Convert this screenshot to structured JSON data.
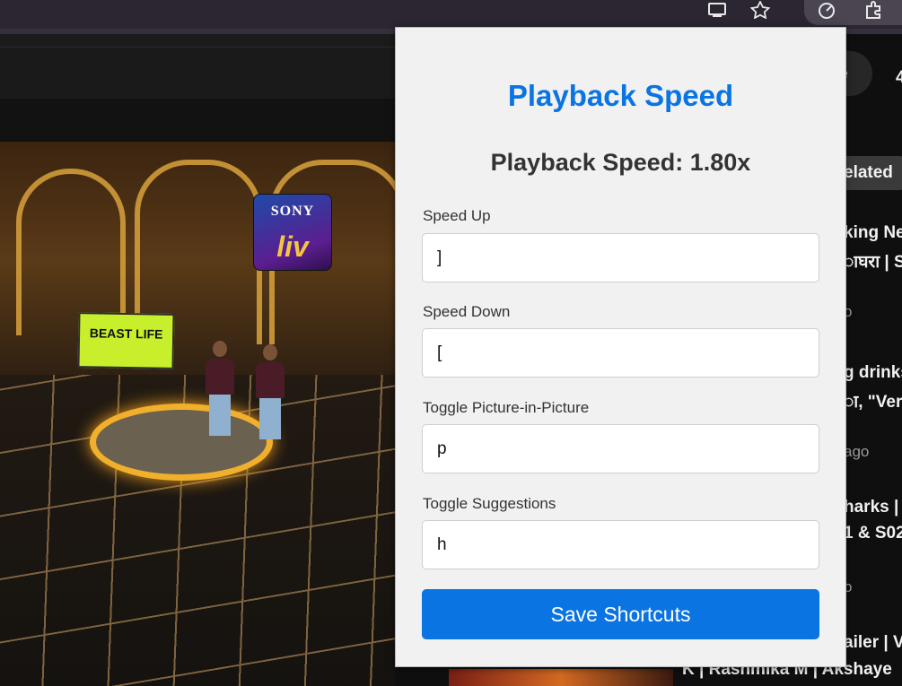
{
  "browser": {
    "icons": [
      "cast-icon",
      "bookmark-star-icon",
      "speed-extension-icon",
      "extensions-puzzle-icon"
    ]
  },
  "video": {
    "logo_top": "SONY",
    "logo_bottom": "liv",
    "banner": "BEAST LIFE"
  },
  "sidebar": {
    "partial_button": "e",
    "partial_edge_char": "4",
    "related_chip": "elated",
    "items": [
      {
        "title_line1": "king Ne",
        "title_line2": "ाघरा | S",
        "meta": "o"
      },
      {
        "title_line1": "g drinks",
        "title_line2": "ा, \"Very",
        "meta": "ago"
      },
      {
        "title_line1": "harks |",
        "title_line2": "1 & S02",
        "meta": "o"
      },
      {
        "title_line1": "ailer | V",
        "title_line2": "",
        "meta": ""
      }
    ],
    "bottom_title": "K | Rashmika M | Akshaye"
  },
  "popup": {
    "title": "Playback Speed",
    "speed_display": "Playback Speed: 1.80x",
    "fields": [
      {
        "label": "Speed Up",
        "value": "]"
      },
      {
        "label": "Speed Down",
        "value": "["
      },
      {
        "label": "Toggle Picture-in-Picture",
        "value": "p"
      },
      {
        "label": "Toggle Suggestions",
        "value": "h"
      }
    ],
    "save_label": "Save Shortcuts",
    "accent": "#0a74e3"
  }
}
